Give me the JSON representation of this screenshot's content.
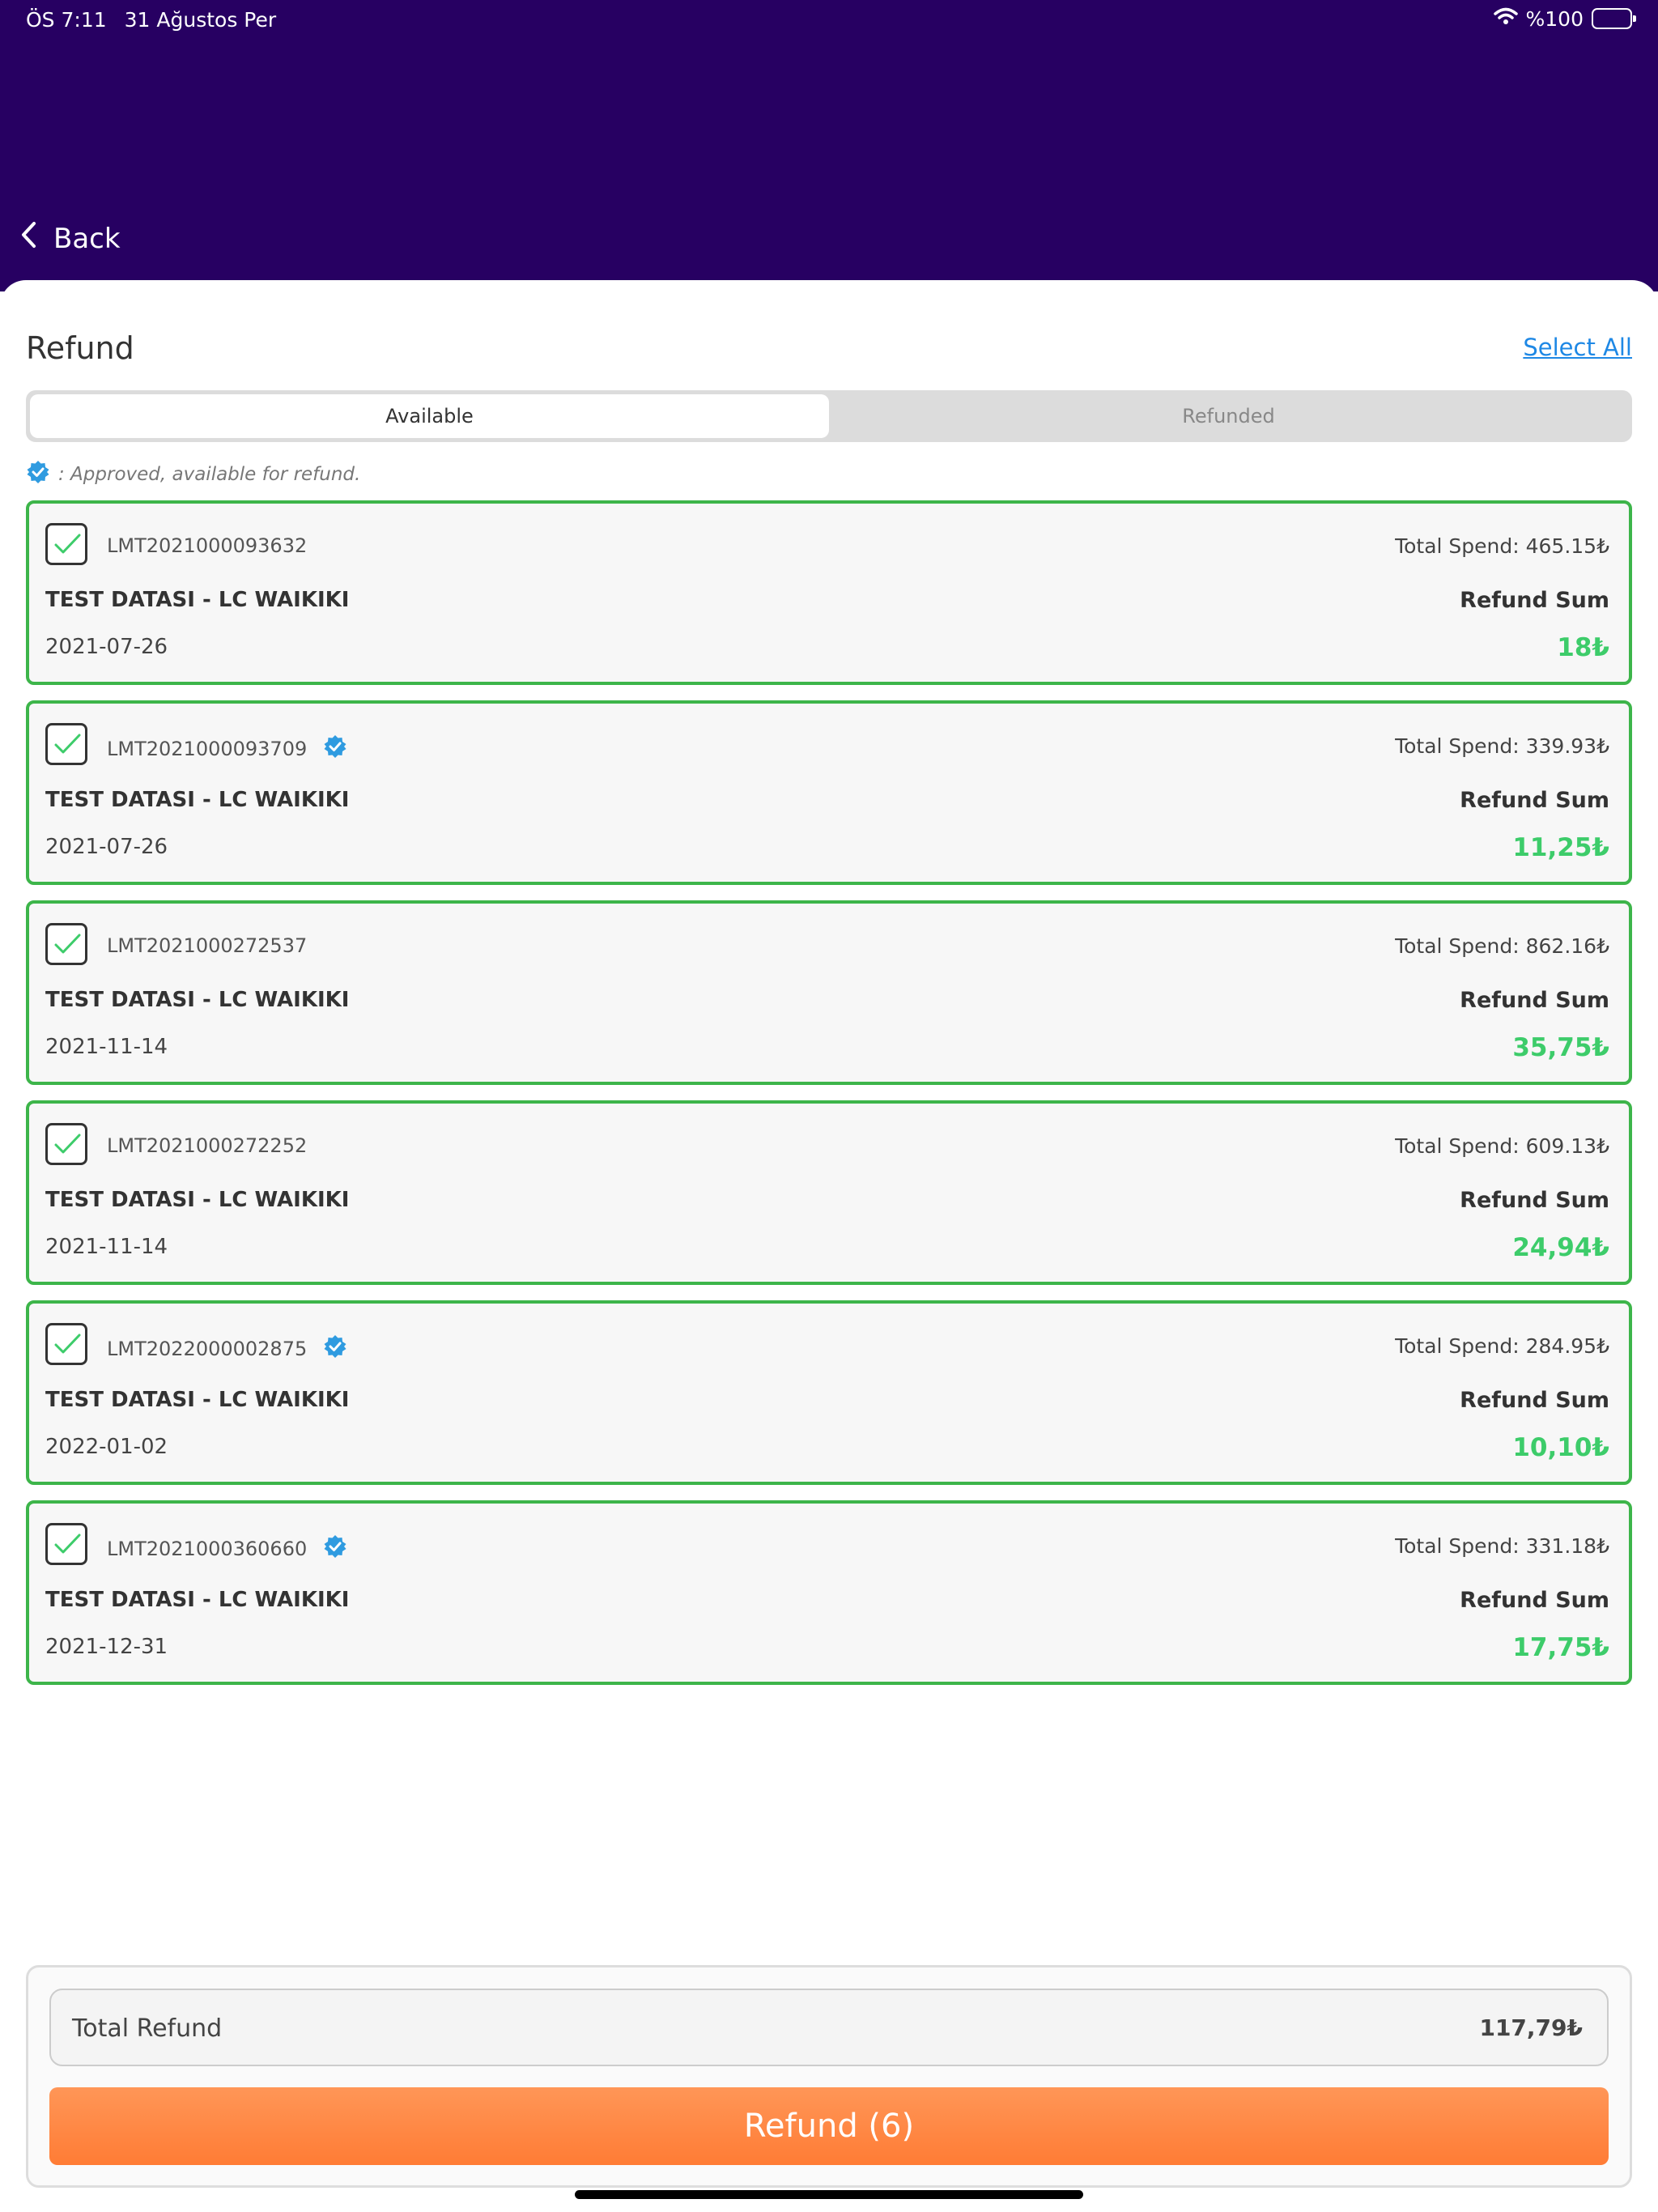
{
  "status_bar": {
    "time": "ÖS 7:11",
    "date": "31 Ağustos Per",
    "battery": "%100"
  },
  "nav": {
    "back_label": "Back"
  },
  "page": {
    "title": "Refund",
    "select_all": "Select All"
  },
  "tabs": [
    {
      "label": "Available",
      "active": true
    },
    {
      "label": "Refunded",
      "active": false
    }
  ],
  "legend": {
    "text": ": Approved, available for refund."
  },
  "items": [
    {
      "id": "LMT2021000093632",
      "verified": false,
      "total_spend": "Total Spend: 465.15₺",
      "store": "TEST DATASI - LC WAIKIKI",
      "refund_label": "Refund Sum",
      "date": "2021-07-26",
      "amount": "18₺",
      "checked": true
    },
    {
      "id": "LMT2021000093709",
      "verified": true,
      "total_spend": "Total Spend: 339.93₺",
      "store": "TEST DATASI - LC WAIKIKI",
      "refund_label": "Refund Sum",
      "date": "2021-07-26",
      "amount": "11,25₺",
      "checked": true
    },
    {
      "id": "LMT2021000272537",
      "verified": false,
      "total_spend": "Total Spend: 862.16₺",
      "store": "TEST DATASI - LC WAIKIKI",
      "refund_label": "Refund Sum",
      "date": "2021-11-14",
      "amount": "35,75₺",
      "checked": true
    },
    {
      "id": "LMT2021000272252",
      "verified": false,
      "total_spend": "Total Spend: 609.13₺",
      "store": "TEST DATASI - LC WAIKIKI",
      "refund_label": "Refund Sum",
      "date": "2021-11-14",
      "amount": "24,94₺",
      "checked": true
    },
    {
      "id": "LMT2022000002875",
      "verified": true,
      "total_spend": "Total Spend: 284.95₺",
      "store": "TEST DATASI - LC WAIKIKI",
      "refund_label": "Refund Sum",
      "date": "2022-01-02",
      "amount": "10,10₺",
      "checked": true
    },
    {
      "id": "LMT2021000360660",
      "verified": true,
      "total_spend": "Total Spend: 331.18₺",
      "store": "TEST DATASI - LC WAIKIKI",
      "refund_label": "Refund Sum",
      "date": "2021-12-31",
      "amount": "17,75₺",
      "checked": true
    }
  ],
  "summary": {
    "total_label": "Total Refund",
    "total_value": "117,79₺",
    "button_label": "Refund (6)"
  },
  "colors": {
    "header_bg": "#270062",
    "card_border": "#3DB54A",
    "amount_green": "#3DCC6A",
    "button_orange": "#FF8A45",
    "link_blue": "#1E88E5",
    "verified_blue": "#2F9BE0"
  },
  "icons": {
    "back": "chevron-left-icon",
    "wifi": "wifi-icon",
    "battery": "battery-icon",
    "verified": "verified-badge-icon",
    "check": "checkmark-icon"
  }
}
